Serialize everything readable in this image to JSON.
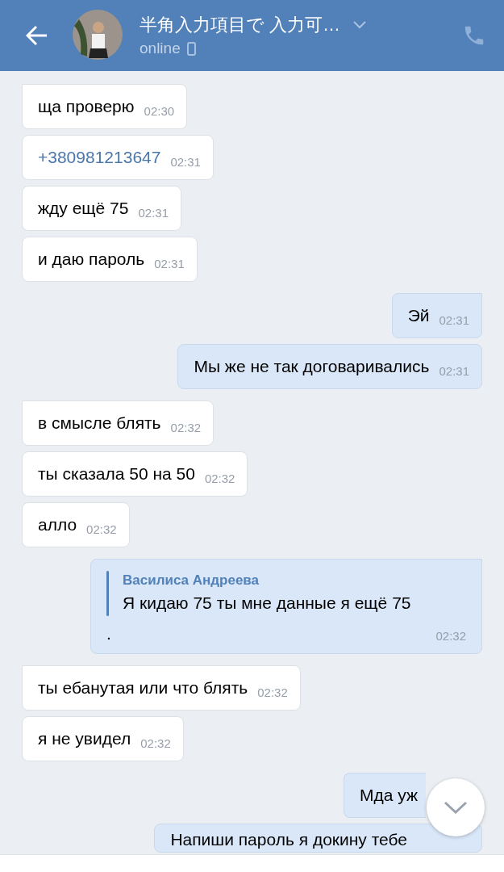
{
  "header": {
    "title": "半角入力項目で 入力可…",
    "status": "online"
  },
  "messages": [
    {
      "outgoing": false,
      "kind": "text",
      "text": "ща проверю",
      "time": "02:30",
      "group_start": true
    },
    {
      "outgoing": false,
      "kind": "link",
      "text": "+380981213647",
      "time": "02:31",
      "group_start": false
    },
    {
      "outgoing": false,
      "kind": "text",
      "text": "жду ещё 75",
      "time": "02:31",
      "group_start": false
    },
    {
      "outgoing": false,
      "kind": "text",
      "text": "и даю пароль",
      "time": "02:31",
      "group_start": false
    },
    {
      "outgoing": true,
      "kind": "text",
      "text": "Эй",
      "time": "02:31",
      "group_start": true
    },
    {
      "outgoing": true,
      "kind": "text",
      "text": "Мы же не так договаривались",
      "time": "02:31",
      "group_start": false
    },
    {
      "outgoing": false,
      "kind": "text",
      "text": "в смысле блять",
      "time": "02:32",
      "group_start": true
    },
    {
      "outgoing": false,
      "kind": "text",
      "text": "ты сказала 50 на 50",
      "time": "02:32",
      "group_start": false
    },
    {
      "outgoing": false,
      "kind": "text",
      "text": "алло",
      "time": "02:32",
      "group_start": false
    },
    {
      "outgoing": true,
      "kind": "reply",
      "author": "Василиса Андреева",
      "quote": "Я кидаю 75 ты мне данные я ещё 75",
      "text": ".",
      "time": "02:32",
      "group_start": true
    },
    {
      "outgoing": false,
      "kind": "text",
      "text": "ты ебанутая или что блять",
      "time": "02:32",
      "group_start": true
    },
    {
      "outgoing": false,
      "kind": "text",
      "text": "я не увидел",
      "time": "02:32",
      "group_start": false
    },
    {
      "outgoing": true,
      "kind": "text",
      "text": "Мда уж",
      "group_start": true
    },
    {
      "outgoing": true,
      "kind": "text",
      "text": "Напиши пароль я докину тебе",
      "group_start": false
    }
  ]
}
